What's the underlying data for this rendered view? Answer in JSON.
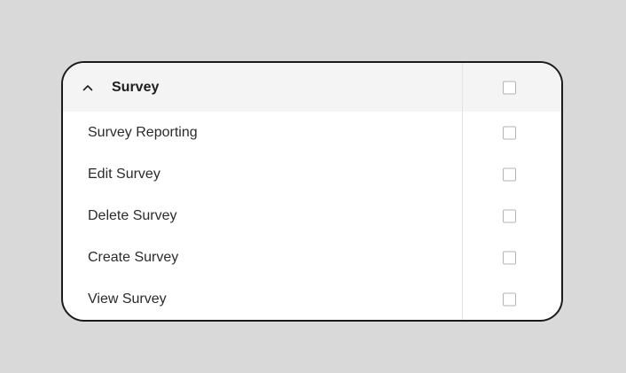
{
  "group": {
    "title": "Survey",
    "expanded": true,
    "checked": false,
    "icon": "chevron-up-icon"
  },
  "items": [
    {
      "label": "Survey Reporting",
      "checked": false
    },
    {
      "label": "Edit Survey",
      "checked": false
    },
    {
      "label": "Delete Survey",
      "checked": false
    },
    {
      "label": "Create Survey",
      "checked": false
    },
    {
      "label": "View Survey",
      "checked": false
    }
  ]
}
